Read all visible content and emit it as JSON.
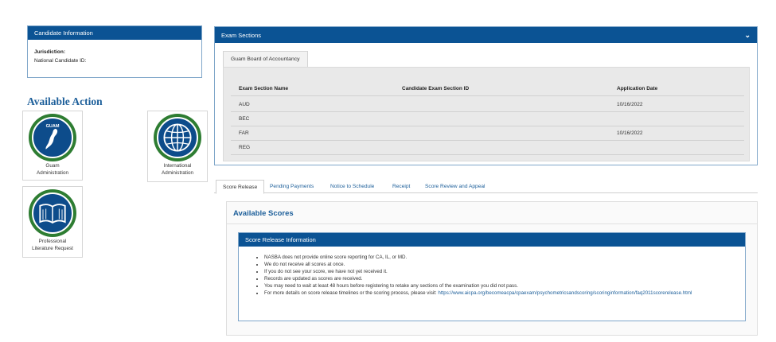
{
  "candidate": {
    "header": "Candidate Information",
    "jurisdiction_label": "Jurisdiction:",
    "national_id_label": "National Candidate ID:"
  },
  "available_action": {
    "title": "Available Action",
    "items": [
      {
        "line1": "Guam",
        "line2": "Administration",
        "icon": "guam-map-icon",
        "badge": "GUAM"
      },
      {
        "line1": "International",
        "line2": "Administration",
        "icon": "globe-icon"
      },
      {
        "line1": "Professional",
        "line2": "Literature Request",
        "icon": "book-icon"
      }
    ]
  },
  "exam_sections": {
    "header": "Exam Sections",
    "tab": "Guam Board of Accountancy",
    "columns": [
      "Exam Section Name",
      "Candidate Exam Section ID",
      "Application Date"
    ],
    "rows": [
      {
        "name": "AUD",
        "id": "",
        "date": "10/16/2022"
      },
      {
        "name": "BEC",
        "id": "",
        "date": ""
      },
      {
        "name": "FAR",
        "id": "",
        "date": "10/16/2022"
      },
      {
        "name": "REG",
        "id": "",
        "date": ""
      }
    ]
  },
  "tabs": [
    "Score Release",
    "Pending Payments",
    "Notice to Schedule",
    "Receipt",
    "Score Review and Appeal"
  ],
  "scores": {
    "title": "Available Scores",
    "info_header": "Score Release Information",
    "bullets": [
      "NASBA does not provide online score reporting for CA, IL, or MD.",
      "We do not receive all scores at once.",
      "If you do not see your score, we have not yet received it.",
      "Records are updated as scores are received.",
      "You may need to wait at least 48 hours before registering to retake any sections of the examination you did not pass."
    ],
    "last_bullet_text": "For more details on score release timelines or the scoring process, please visit: ",
    "link": "https://www.aicpa.org/becomeacpa/cpaexam/psychometricsandscoring/scoringinformation/faq2011scorerelease.html"
  },
  "colors": {
    "primary": "#0b5394",
    "heading": "#1d5f9a",
    "icon_ring": "#2e7d32"
  }
}
